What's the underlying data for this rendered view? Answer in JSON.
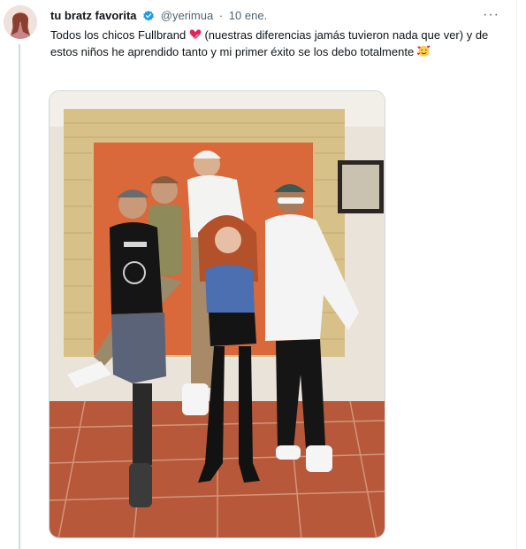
{
  "tweet": {
    "display_name": "tu bratz favorita",
    "handle": "@yerimua",
    "separator": "·",
    "date": "10 ene.",
    "more_glyph": "···",
    "text": "Todos los chicos Fullbrand",
    "text_rest": " (nuestras diferencias jamás tuvieron nada que ver) y de estos niños he aprendido tanto y mi primer éxito se los debo totalmente",
    "emoji_1": "heart-emoji",
    "emoji_2": "smiling-face-with-hearts-emoji"
  },
  "media": {
    "type": "photo",
    "subject": "group-photo"
  },
  "colors": {
    "verified": "#1d9bf0",
    "text": "#0f1419",
    "secondary": "#536471",
    "divider": "#cfd9de"
  }
}
